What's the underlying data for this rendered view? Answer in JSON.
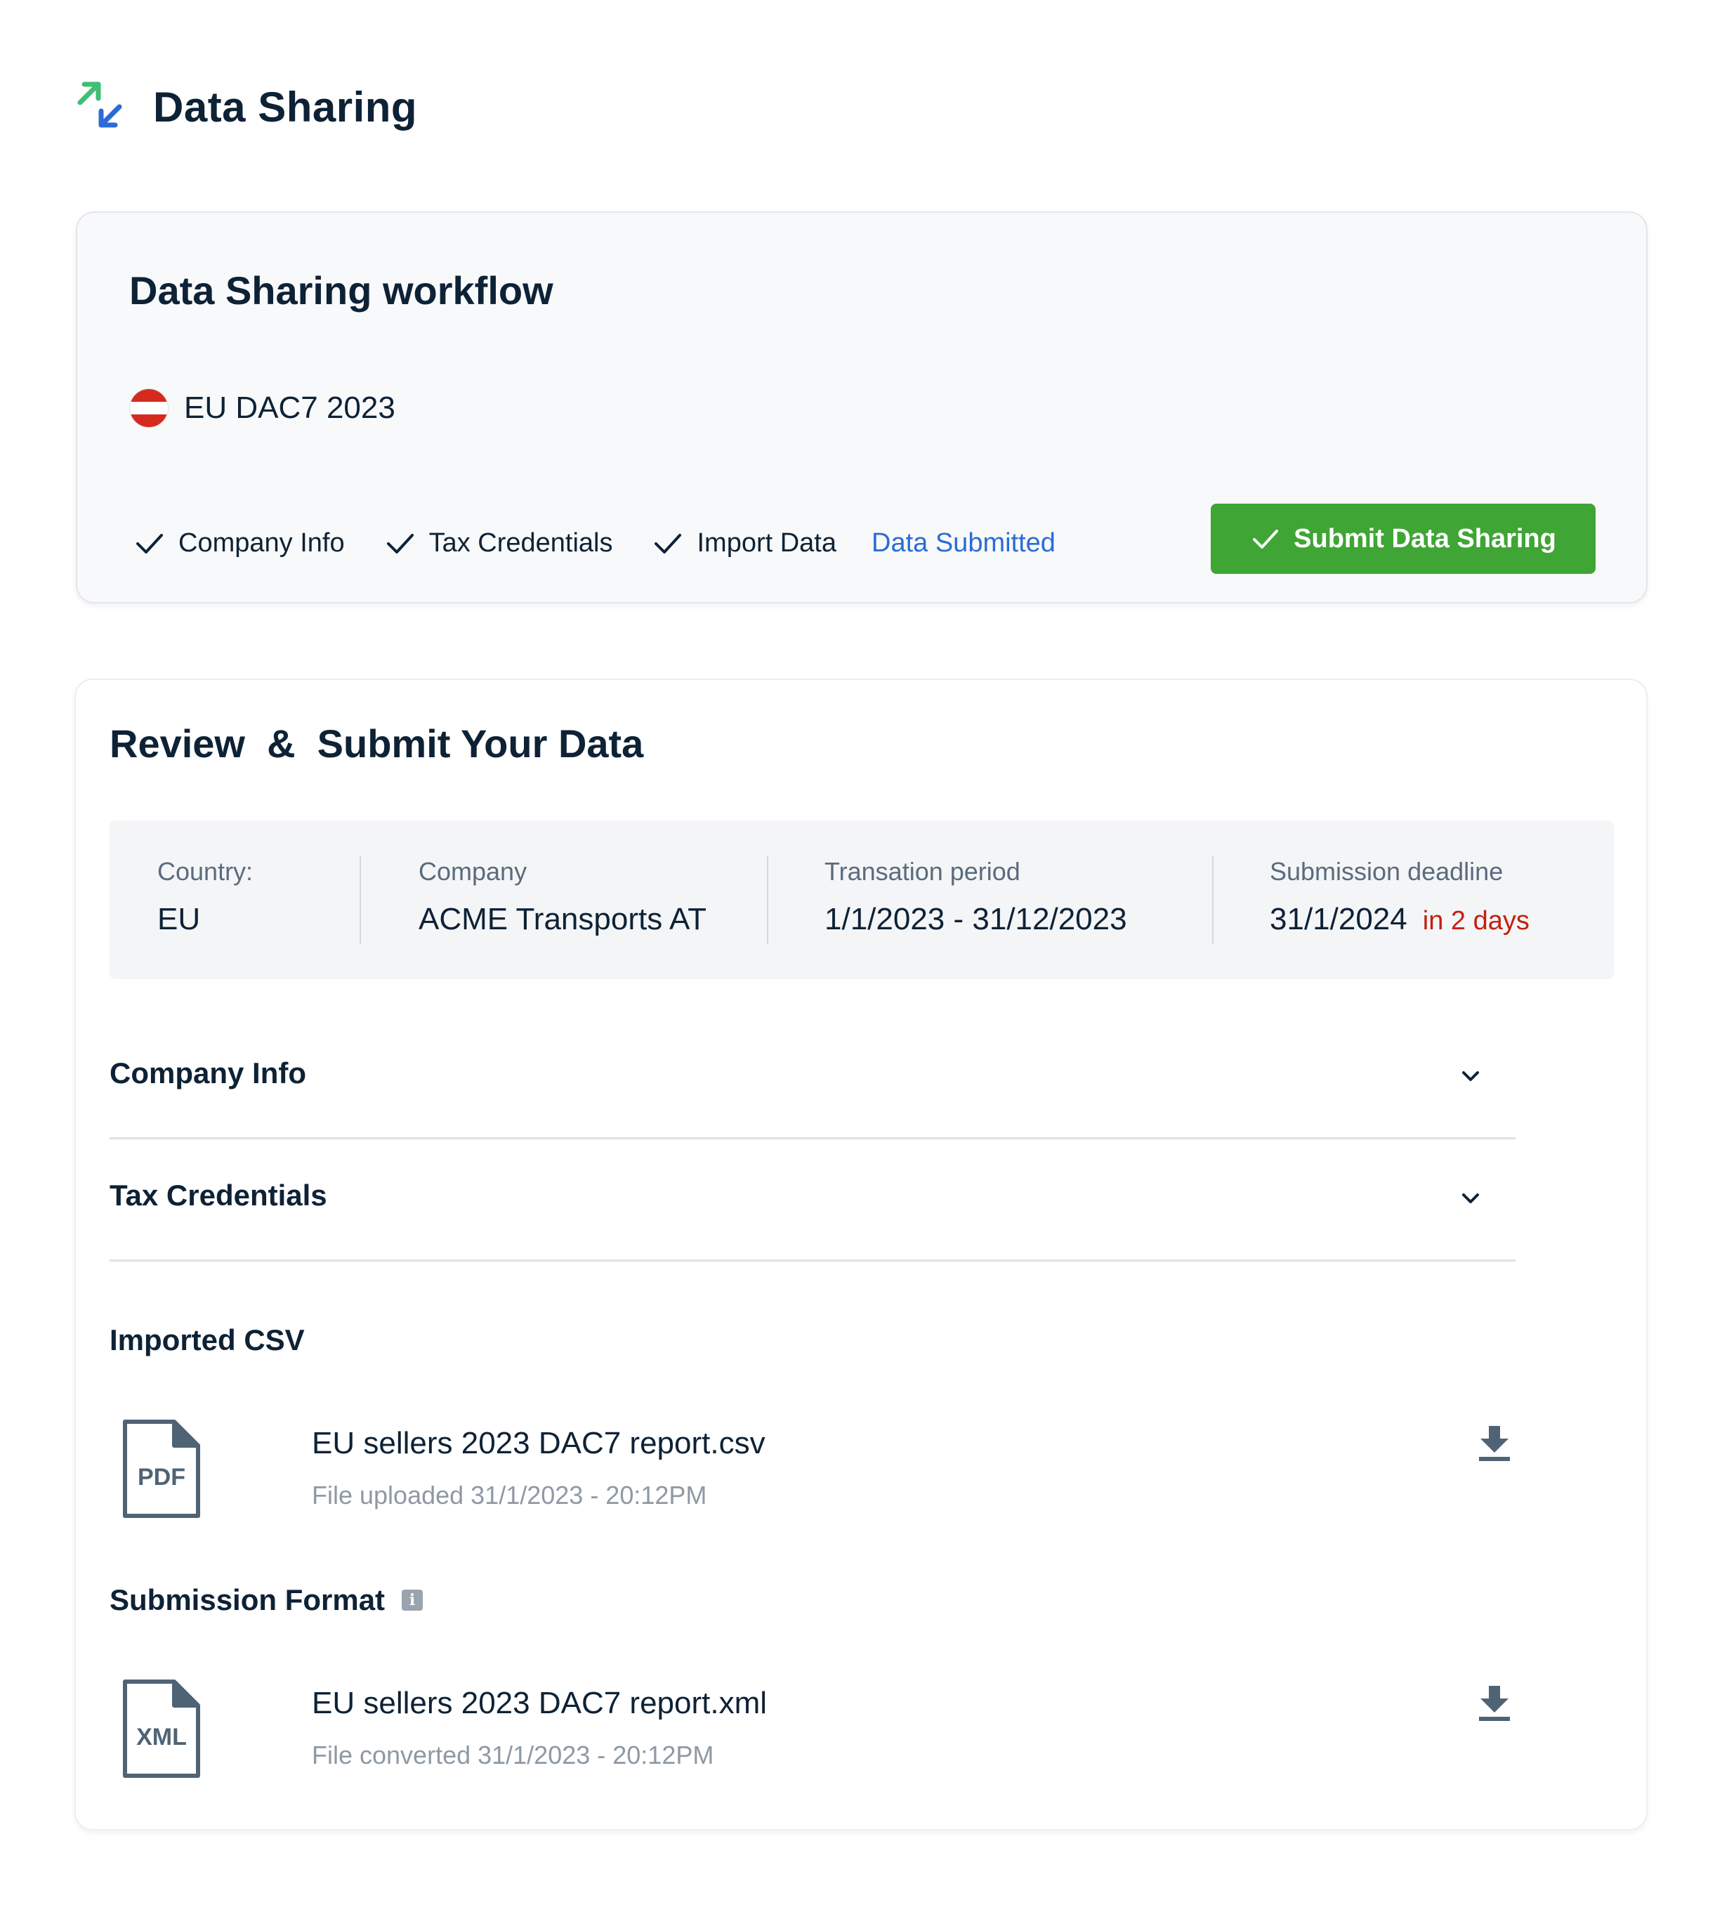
{
  "header": {
    "title": "Data Sharing",
    "icon": "arrows-exchange-icon"
  },
  "workflow": {
    "title": "Data Sharing workflow",
    "program": {
      "label": "EU DAC7 2023",
      "flag": "austria-flag-icon"
    },
    "steps": [
      {
        "label": "Company Info",
        "status": "done"
      },
      {
        "label": "Tax Credentials",
        "status": "done"
      },
      {
        "label": "Import Data",
        "status": "done"
      }
    ],
    "active_step": "Data Submitted",
    "submit_label": "Submit Data Sharing"
  },
  "review": {
    "title": "Review  &  Submit Your Data",
    "summary": {
      "country_label": "Country:",
      "country_value": "EU",
      "company_label": "Company",
      "company_value": "ACME Transports AT",
      "period_label": "Transation period",
      "period_value": "1/1/2023 - 31/12/2023",
      "deadline_label": "Submission deadline",
      "deadline_value": "31/1/2024",
      "deadline_note": "in 2 days"
    },
    "accordions": [
      {
        "label": "Company Info"
      },
      {
        "label": "Tax Credentials"
      }
    ],
    "imported": {
      "title": "Imported CSV",
      "file_type": "PDF",
      "file_name": "EU sellers 2023 DAC7 report.csv",
      "file_meta": "File uploaded 31/1/2023 - 20:12PM"
    },
    "format": {
      "title": "Submission Format",
      "file_type": "XML",
      "file_name": "EU sellers 2023 DAC7 report.xml",
      "file_meta": "File converted 31/1/2023 - 20:12PM"
    }
  },
  "colors": {
    "accent_blue": "#2c6bd6",
    "success_green": "#3fa534",
    "warning_red": "#c4200f",
    "text_primary": "#0e2236"
  }
}
